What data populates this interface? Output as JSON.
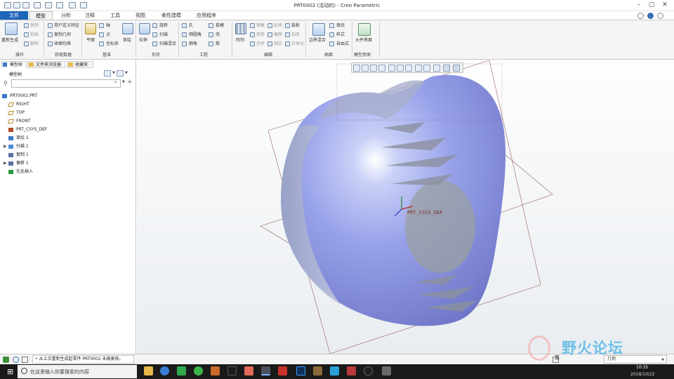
{
  "window": {
    "title": "PRT0002 (活动的) - Creo Parametric"
  },
  "tabs": [
    "文件",
    "模型",
    "分析",
    "注释",
    "工具",
    "视图",
    "柔性建模",
    "应用程序"
  ],
  "ribbon": {
    "operations": {
      "regen": "重新生成",
      "copy": "复制",
      "paste": "粘贴",
      "delete": "删除",
      "group": "操作"
    },
    "get_data": {
      "udf": "用户定义特征",
      "copy_geom": "复制几何",
      "shrinkwrap": "收缩包络",
      "group": "获取数据"
    },
    "datum": {
      "plane": "平面",
      "axis": "轴",
      "point": "点",
      "csys": "坐标系",
      "sketch": "草绘",
      "group": "基准"
    },
    "shapes": {
      "extrude": "拉伸",
      "revolve": "旋转",
      "sweep": "扫描",
      "swept_blend": "扫描混合",
      "group": "形状"
    },
    "engineering": {
      "hole": "孔",
      "round": "倒圆角",
      "chamfer": "倒角",
      "draft": "拔模",
      "shell": "壳",
      "rib": "筋",
      "group": "工程"
    },
    "editing": {
      "pattern": "阵列",
      "mirror": "镜像",
      "trim": "修剪",
      "merge": "合并",
      "extend": "延伸",
      "offset": "偏移",
      "intersect": "相交",
      "project": "投影",
      "thicken": "加厚",
      "solidify": "实体化",
      "group": "编辑"
    },
    "surfaces": {
      "boundary_blend": "边界混合",
      "fill": "填充",
      "style": "样式",
      "freestyle": "自由式",
      "group": "曲面"
    },
    "model_intent": {
      "component_interface": "元件界面",
      "group": "模型意图"
    }
  },
  "left_panel": {
    "tabs": [
      "模型树",
      "文件夹浏览器",
      "收藏夹"
    ],
    "header": "模型树",
    "tree": [
      {
        "label": "PRT0002.PRT",
        "icon": "part-icon",
        "expand": ""
      },
      {
        "label": "RIGHT",
        "icon": "datum-plane-icon",
        "expand": ""
      },
      {
        "label": "TOP",
        "icon": "datum-plane-icon",
        "expand": ""
      },
      {
        "label": "FRONT",
        "icon": "datum-plane-icon",
        "expand": ""
      },
      {
        "label": "PRT_CSYS_DEF",
        "icon": "csys-icon",
        "expand": ""
      },
      {
        "label": "草绘 1",
        "icon": "sketch-icon",
        "expand": ""
      },
      {
        "label": "扫描 1",
        "icon": "sweep-icon",
        "expand": "▶"
      },
      {
        "label": "复制 1",
        "icon": "copy-icon",
        "expand": ""
      },
      {
        "label": "偏移 1",
        "icon": "offset-icon",
        "expand": "▶"
      },
      {
        "label": "在此插入",
        "icon": "insert-here-icon",
        "expand": ""
      }
    ]
  },
  "viewport": {
    "csys_label": "PRT_CSYS_DEF"
  },
  "status": {
    "message": "• 从上次重新生成起零件 PRT0002 未被更改。",
    "filter": "几何"
  },
  "taskbar": {
    "search_placeholder": "在这里输入你要搜索的内容",
    "time": "10:35",
    "date": "2018/10/22",
    "ime": "英",
    "watermark": "野火论坛"
  }
}
